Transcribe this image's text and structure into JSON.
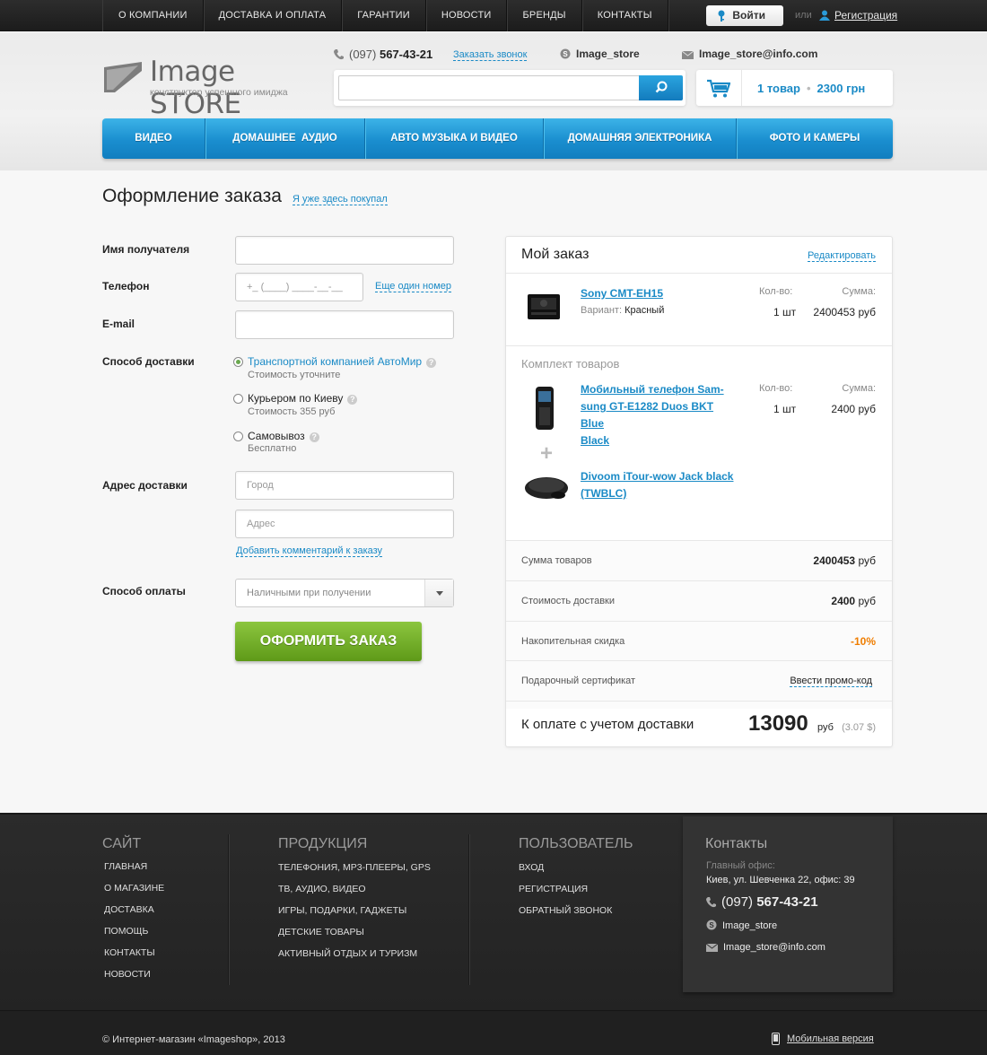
{
  "topnav": [
    "О КОМПАНИИ",
    "ДОСТАВКА И ОПЛАТА",
    "ГАРАНТИИ",
    "НОВОСТИ",
    "БРЕНДЫ",
    "КОНТАКТЫ"
  ],
  "auth": {
    "login": "Войти",
    "or": "или",
    "register": "Регистрация"
  },
  "logo": {
    "word1": "Image",
    "word2": "STORE",
    "tagline": "конструктор успешного имиджа"
  },
  "contacts_header": {
    "phone_code": "(097)",
    "phone_number": "567-43-21",
    "callback": "Заказать звонок",
    "skype": "Image_store",
    "email": "Image_store@info.com"
  },
  "search": {
    "value": ""
  },
  "cart": {
    "items": "1 товар",
    "sum": "2300 грн"
  },
  "mainmenu": [
    "ВИДЕО",
    "ДОМАШНЕЕ  АУДИО",
    "АВТО МУЗЫКА И ВИДЕО",
    "ДОМАШНЯЯ ЭЛЕКТРОНИКА",
    "ФОТО И КАМЕРЫ"
  ],
  "page": {
    "title": "Оформление заказа",
    "already": "Я уже здесь покупал"
  },
  "form": {
    "name_label": "Имя получателя",
    "phone_label": "Телефон",
    "phone_placeholder": "+_ (____) ____-__-__",
    "phone_more": "Еще один номер",
    "email_label": "E-mail",
    "delivery_label": "Способ доставки",
    "delivery_options": [
      {
        "label": "Транспортной компанией АвтоМир",
        "sub": "Стоимость уточните",
        "selected": true
      },
      {
        "label": "Курьером по Киеву",
        "sub": "Стоимость 355 руб",
        "selected": false
      },
      {
        "label": "Самовывоз",
        "sub": "Бесплатно",
        "selected": false
      }
    ],
    "address_label": "Адрес доставки",
    "city_placeholder": "Город",
    "address_placeholder": "Адрес",
    "add_comment": "Добавить комментарий к заказу",
    "payment_label": "Способ оплаты",
    "payment_value": "Наличными при получении",
    "submit": "ОФОРМИТЬ ЗАКАЗ"
  },
  "order": {
    "title": "Мой заказ",
    "edit": "Редактировать",
    "qty_label": "Кол-во:",
    "sum_label": "Сумма:",
    "main_item": {
      "name": "Sony CMT-EH15",
      "variant_label": "Вариант:",
      "variant": "Красный",
      "qty": "1 шт",
      "sum": "2400453",
      "cur": "руб"
    },
    "bundle_title": "Комплект товаров",
    "bundle_item1": {
      "name_line1": "Мобильный телефон Sam-",
      "name_line2": "sung GT-E1282 Duos BKT Blue",
      "name_line3": "Black",
      "qty": "1 шт",
      "sum": "2400",
      "cur": "руб"
    },
    "plus": "+",
    "bundle_item2": {
      "name_line1": "Divoom iTour-wow Jack black",
      "name_line2": "(TWBLC)"
    },
    "totals": {
      "goods_label": "Сумма товаров",
      "goods_value": "2400453",
      "goods_cur": "руб",
      "delivery_label": "Стоимость доставки",
      "delivery_value": "2400",
      "delivery_cur": "руб",
      "discount_label": "Накопительная скидка",
      "discount_value": "-10%",
      "gift_label": "Подарочный сертификат",
      "gift_link": "Ввести промо-код"
    },
    "grand": {
      "label": "К оплате с учетом доставки",
      "value": "13090",
      "cur": "руб",
      "usd": "(3.07 $)"
    }
  },
  "footer": {
    "site": {
      "title": "САЙТ",
      "links": [
        "ГЛАВНАЯ",
        "О МАГАЗИНЕ",
        "ДОСТАВКА",
        "ПОМОЩЬ",
        "КОНТАКТЫ",
        "НОВОСТИ"
      ]
    },
    "products": {
      "title": "ПРОДУКЦИЯ",
      "links": [
        "ТЕЛЕФОНИЯ, MP3-ПЛЕЕРЫ, GPS",
        "ТВ, АУДИО, ВИДЕО",
        "ИГРЫ, ПОДАРКИ, ГАДЖЕТЫ",
        "ДЕТСКИЕ ТОВАРЫ",
        "АКТИВНЫЙ ОТДЫХ И ТУРИЗМ"
      ]
    },
    "user": {
      "title": "ПОЛЬЗОВАТЕЛЬ",
      "links": [
        "ВХОД",
        "РЕГИСТРАЦИЯ",
        "ОБРАТНЫЙ ЗВОНОК"
      ]
    },
    "contacts": {
      "title": "Контакты",
      "office_label": "Главный офис:",
      "office_address": "Киев, ул. Шевченка 22, офис: 39",
      "phone_code": "(097)",
      "phone_number": "567-43-21",
      "skype": "Image_store",
      "email": "Image_store@info.com"
    },
    "copyright": "© Интернет-магазин «Imageshop»,  2013",
    "mobile": "Мобильная версия"
  },
  "colors": {
    "accent": "#1a8ac6",
    "green": "#6aa84f",
    "discount": "#ef7d00",
    "dark": "#262626"
  }
}
